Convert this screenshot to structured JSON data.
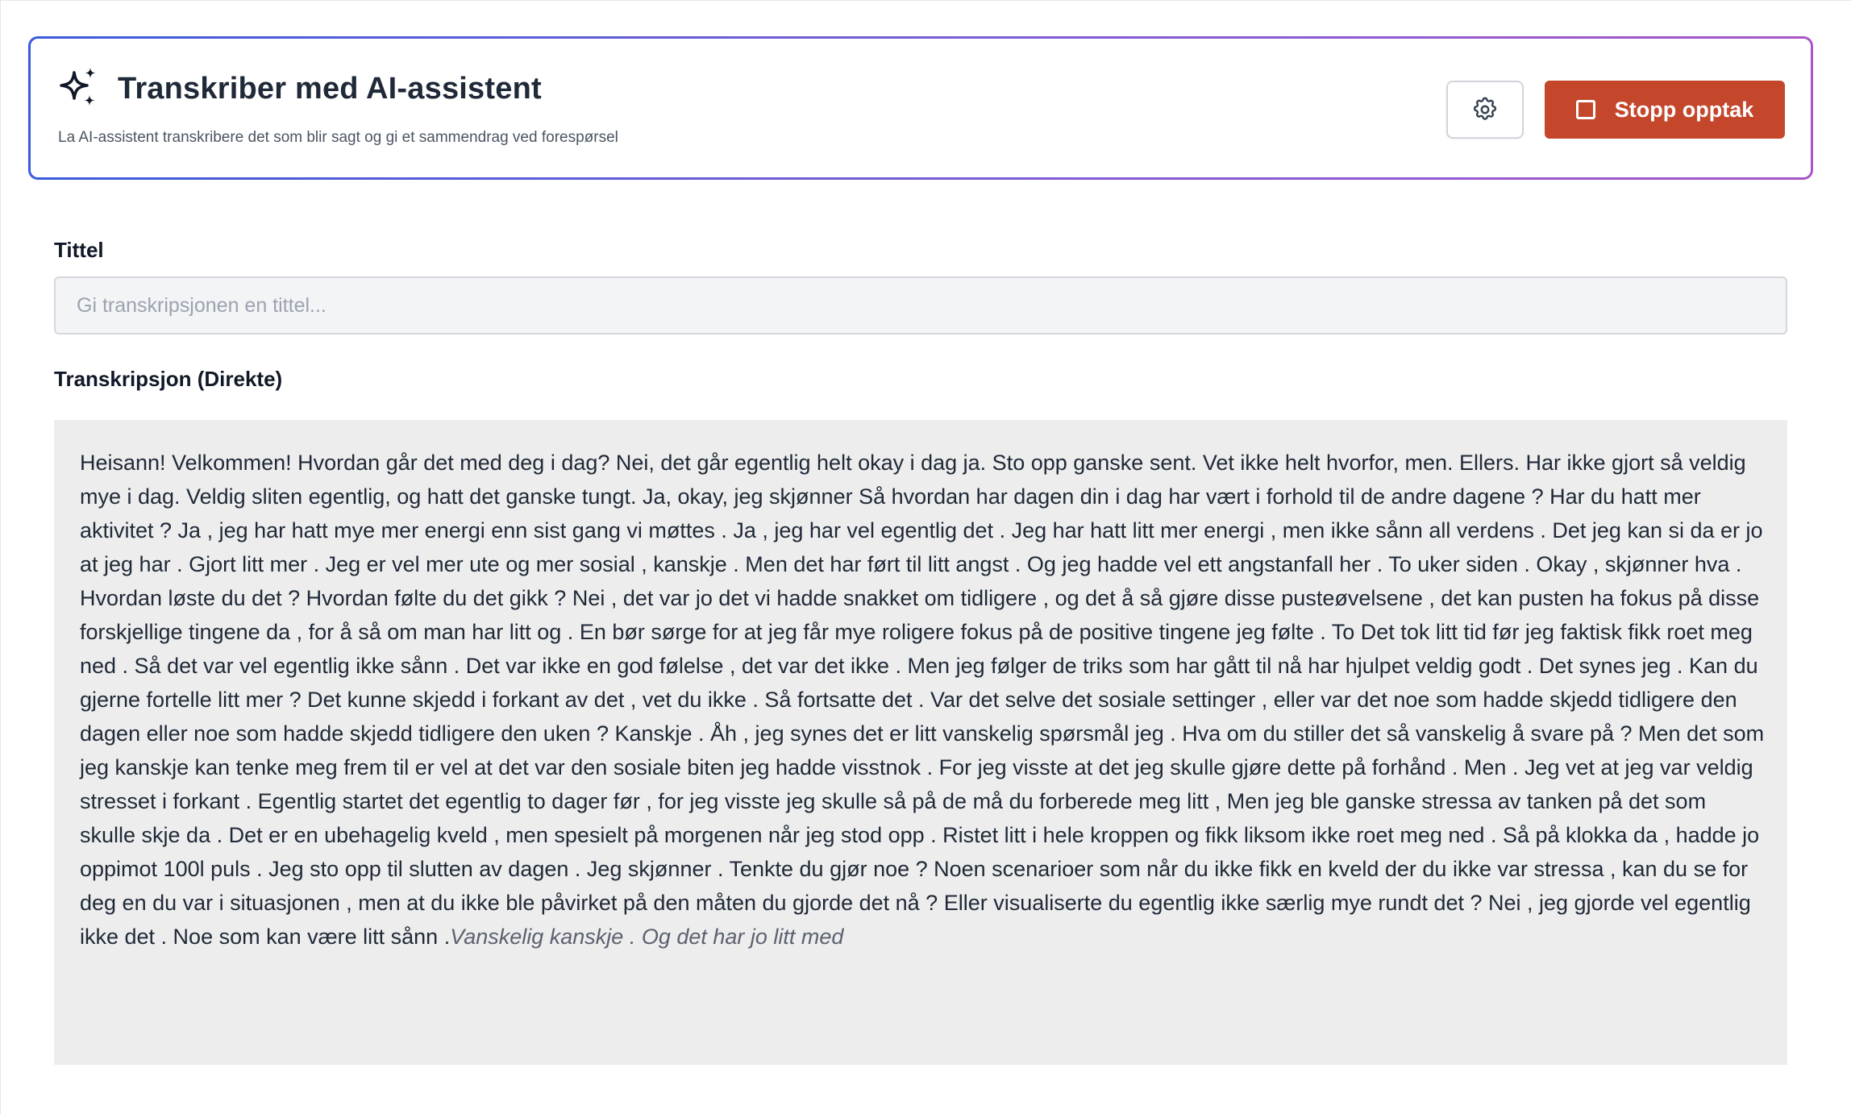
{
  "header": {
    "title": "Transkriber med AI-assistent",
    "subtitle": "La AI-assistent transkribere det som blir sagt og gi et sammendrag ved forespørsel",
    "icon": "sparkles-icon",
    "settings_icon": "gear-icon",
    "stop_label": "Stopp opptak",
    "stop_color": "#c4472c",
    "gradient": [
      "#3b5bdb",
      "#a855c7"
    ]
  },
  "title_field": {
    "label": "Tittel",
    "placeholder": "Gi transkripsjonen en tittel...",
    "value": ""
  },
  "transcript": {
    "label": "Transkripsjon (Direkte)",
    "final_text": "Heisann! Velkommen! Hvordan går det med deg i dag? Nei, det går egentlig helt okay i dag ja. Sto opp ganske sent. Vet ikke helt hvorfor, men. Ellers. Har ikke gjort så veldig mye i dag. Veldig sliten egentlig, og hatt det ganske tungt. Ja, okay, jeg skjønner Så hvordan har dagen din i dag har vært i forhold til de andre dagene ? Har du hatt mer aktivitet ? Ja , jeg har hatt mye mer energi enn sist gang vi møttes . Ja , jeg har vel egentlig det . Jeg har hatt litt mer energi , men ikke sånn all verdens . Det jeg kan si da er jo at jeg har . Gjort litt mer . Jeg er vel mer ute og mer sosial , kanskje . Men det har ført til litt angst . Og jeg hadde vel ett angstanfall her . To uker siden . Okay , skjønner hva . Hvordan løste du det ? Hvordan følte du det gikk ? Nei , det var jo det vi hadde snakket om tidligere , og det å så gjøre disse pusteøvelsene , det kan pusten ha fokus på disse forskjellige tingene da , for å så om man har litt og . En bør sørge for at jeg får mye roligere fokus på de positive tingene jeg følte . To Det tok litt tid før jeg faktisk fikk roet meg ned . Så det var vel egentlig ikke sånn . Det var ikke en god følelse , det var det ikke . Men jeg følger de triks som har gått til nå har hjulpet veldig godt . Det synes jeg . Kan du gjerne fortelle litt mer ? Det kunne skjedd i forkant av det , vet du ikke . Så fortsatte det . Var det selve det sosiale settinger , eller var det noe som hadde skjedd tidligere den dagen eller noe som hadde skjedd tidligere den uken ? Kanskje . Åh , jeg synes det er litt vanskelig spørsmål jeg . Hva om du stiller det så vanskelig å svare på ? Men det som jeg kanskje kan tenke meg frem til er vel at det var den sosiale biten jeg hadde visstnok . For jeg visste at det jeg skulle gjøre dette på forhånd . Men . Jeg vet at jeg var veldig stresset i forkant . Egentlig startet det egentlig to dager før , for jeg visste jeg skulle så på de må du forberede meg litt , Men jeg ble ganske stressa av tanken på det som skulle skje da . Det er en ubehagelig kveld , men spesielt på morgenen når jeg stod opp . Ristet litt i hele kroppen og fikk liksom ikke roet meg ned . Så på klokka da , hadde jo oppimot 100l puls . Jeg sto opp til slutten av dagen . Jeg skjønner . Tenkte du gjør noe ? Noen scenarioer som når du ikke fikk en kveld der du ikke var stressa , kan du se for deg en du var i situasjonen , men at du ikke ble påvirket på den måten du gjorde det nå ? Eller visualiserte du egentlig ikke særlig mye rundt det ? Nei , jeg gjorde vel egentlig ikke det . Noe som kan være litt sånn .",
    "interim_text": "Vanskelig kanskje . Og det har jo litt med"
  }
}
